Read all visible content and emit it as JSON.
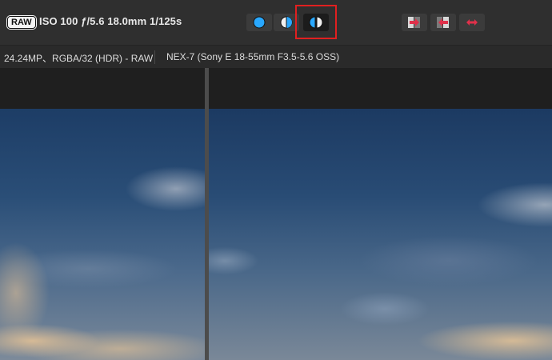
{
  "toolbar": {
    "raw_badge": "RAW",
    "exif": "ISO 100 ƒ/5.6 18.0mm 1/125s",
    "view_buttons": [
      {
        "icon": "full-circle-icon",
        "active": false
      },
      {
        "icon": "split-circle-icon",
        "active": false
      },
      {
        "icon": "side-by-side-icon",
        "active": true
      }
    ],
    "action_buttons": [
      {
        "icon": "arrow-right-icon"
      },
      {
        "icon": "arrow-left-icon"
      },
      {
        "icon": "arrow-both-icon"
      }
    ]
  },
  "infobar": {
    "image_info": "24.24MP、RGBA/32 (HDR) - RAW",
    "camera_info": "NEX-7 (Sony E 18-55mm F3.5-5.6 OSS)"
  },
  "colors": {
    "accent_blue": "#29a8ff",
    "arrow_red": "#e0304a",
    "highlight_red": "#e02020"
  }
}
